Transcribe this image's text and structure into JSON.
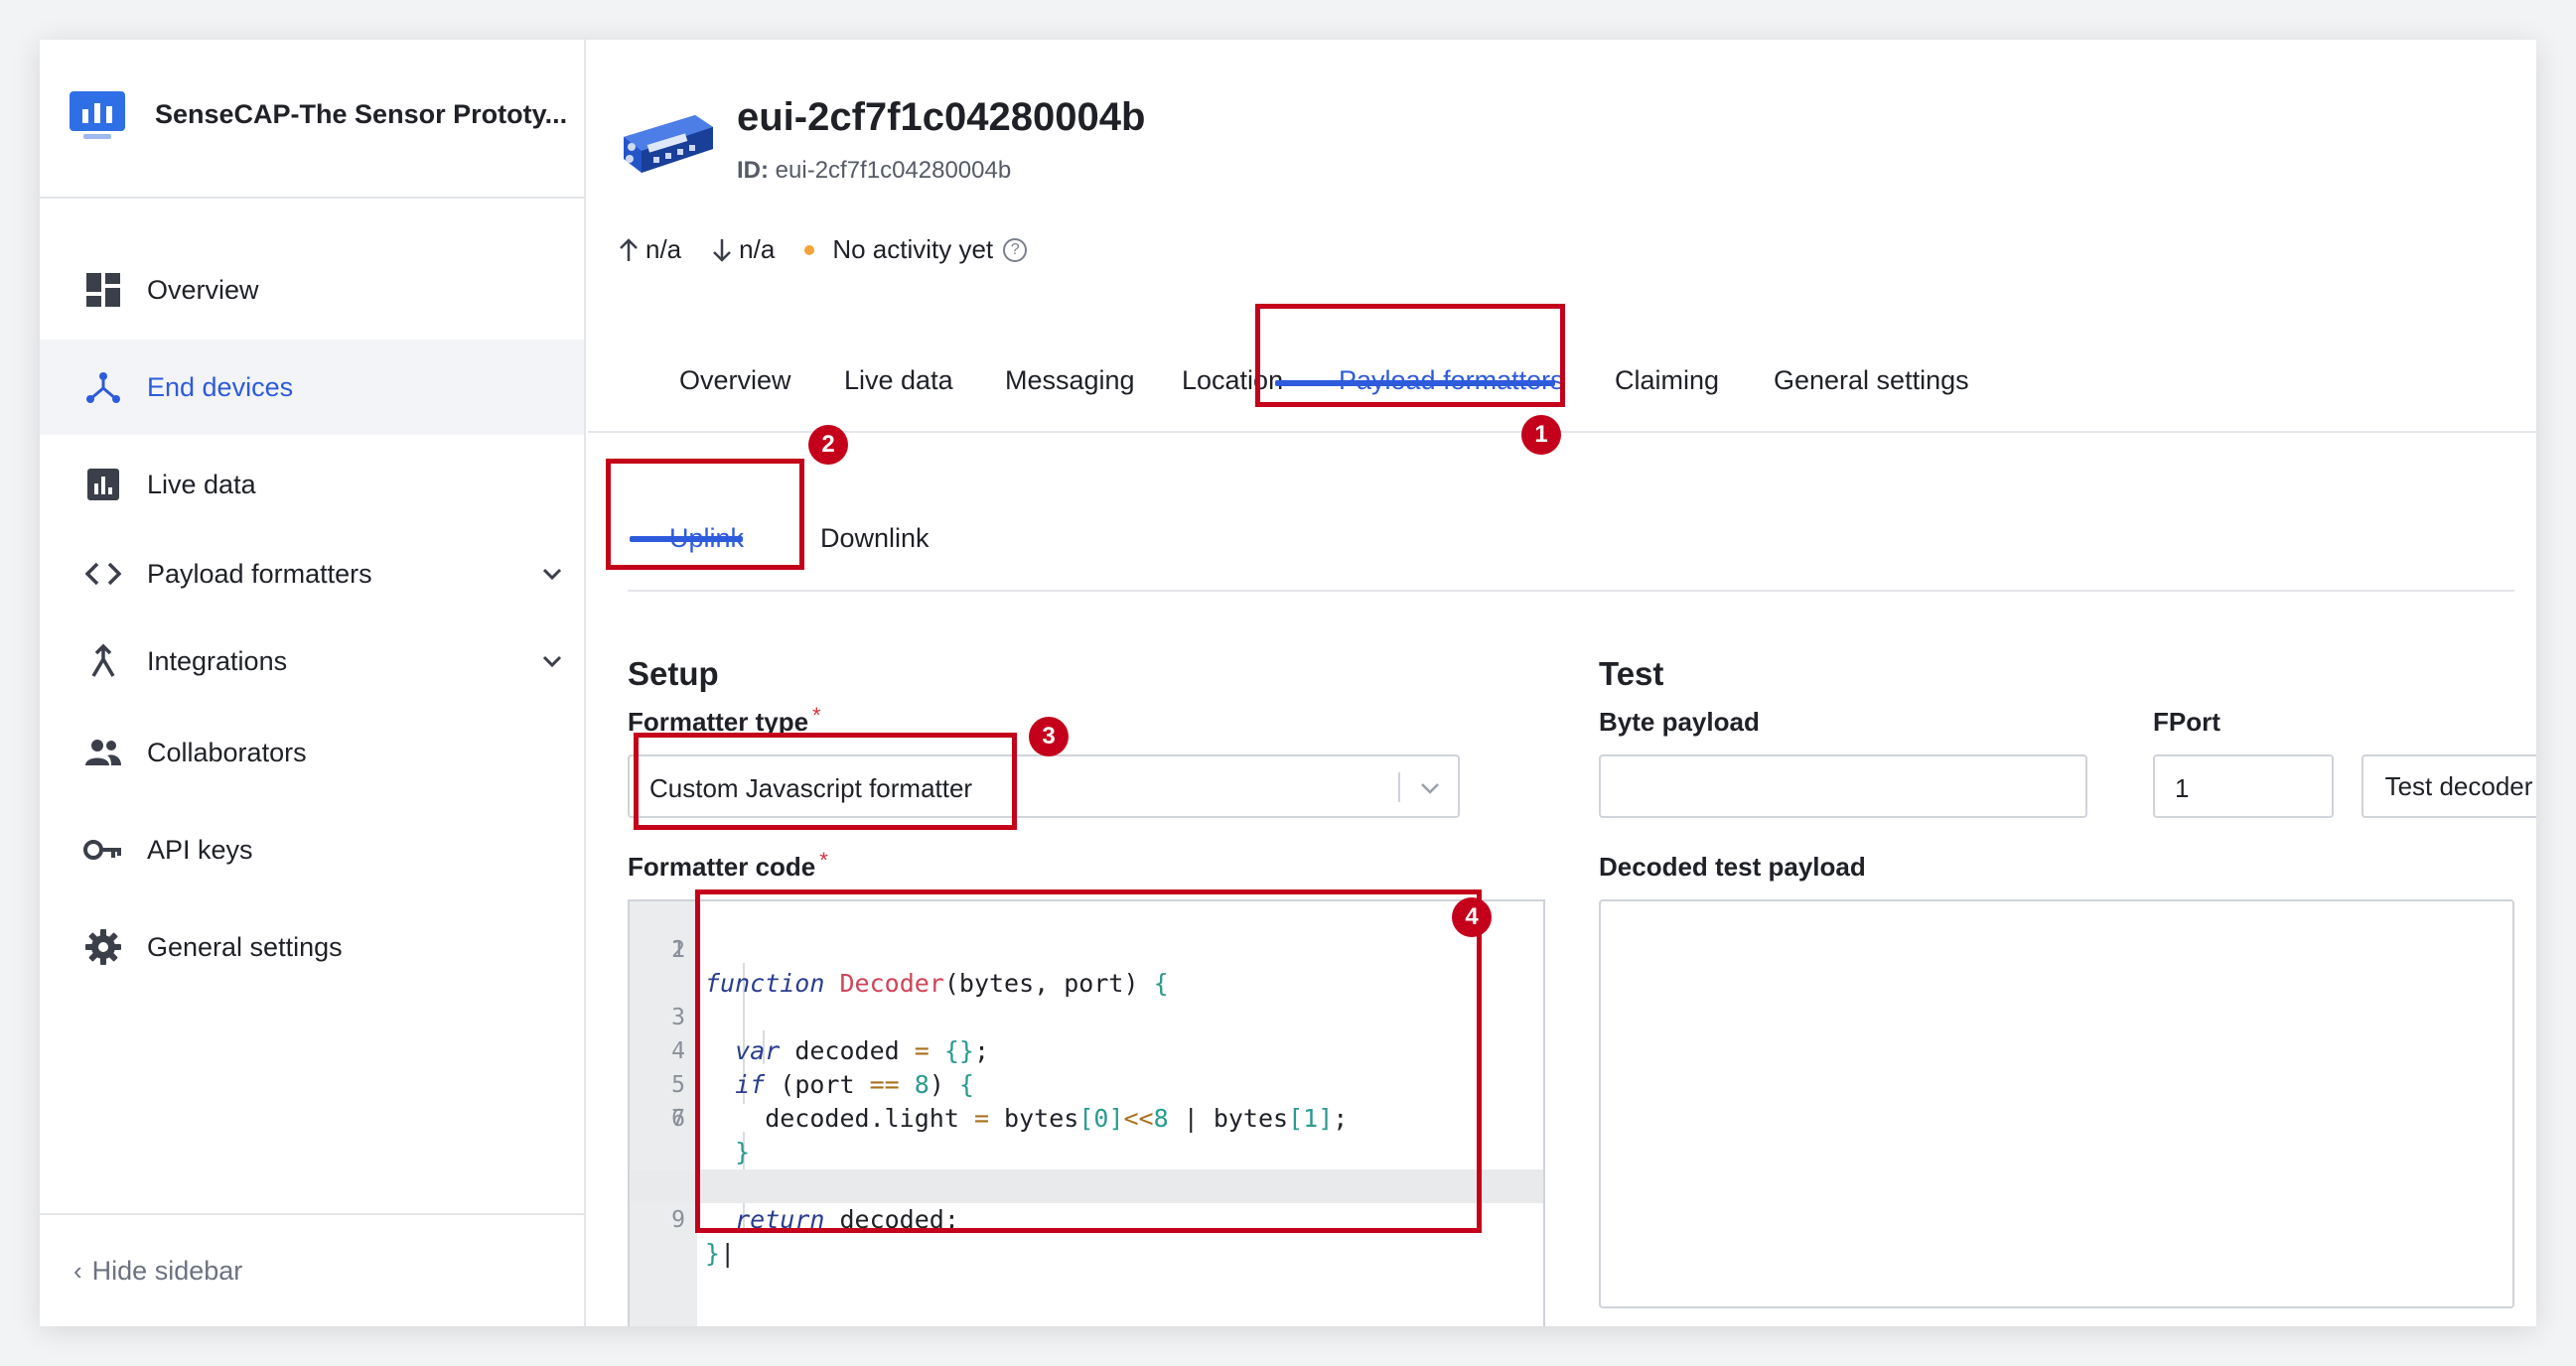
{
  "app": {
    "name": "SenseCAP-The Sensor Prototy..."
  },
  "sidebar": {
    "items": [
      {
        "label": "Overview",
        "icon": "dashboard-icon"
      },
      {
        "label": "End devices",
        "icon": "end-devices-icon",
        "active": true
      },
      {
        "label": "Live data",
        "icon": "live-data-icon"
      },
      {
        "label": "Payload formatters",
        "icon": "code-icon",
        "expandable": true
      },
      {
        "label": "Integrations",
        "icon": "integrations-icon",
        "expandable": true
      },
      {
        "label": "Collaborators",
        "icon": "people-icon"
      },
      {
        "label": "API keys",
        "icon": "key-icon"
      },
      {
        "label": "General settings",
        "icon": "gear-icon"
      }
    ],
    "hide_label": "Hide sidebar"
  },
  "device": {
    "title": "eui-2cf7f1c04280004b",
    "id_label": "ID:",
    "id_value": "eui-2cf7f1c04280004b",
    "uplink_count": "n/a",
    "downlink_count": "n/a",
    "activity": "No activity yet"
  },
  "tabs": [
    "Overview",
    "Live data",
    "Messaging",
    "Location",
    "Payload formatters",
    "Claiming",
    "General settings"
  ],
  "active_tab": "Payload formatters",
  "subtabs": [
    "Uplink",
    "Downlink"
  ],
  "active_subtab": "Uplink",
  "setup": {
    "title": "Setup",
    "formatter_type_label": "Formatter type",
    "formatter_type_value": "Custom Javascript formatter",
    "formatter_code_label": "Formatter code",
    "required_mark": "*",
    "code_lines": [
      "function Decoder(bytes, port) {",
      "",
      "  var decoded = {};",
      "  if (port == 8) {",
      "    decoded.light = bytes[0]<<8 | bytes[1];",
      "  }",
      "",
      "  return decoded;",
      "}"
    ]
  },
  "test": {
    "title": "Test",
    "byte_payload_label": "Byte payload",
    "byte_payload_value": "",
    "fport_label": "FPort",
    "fport_value": "1",
    "test_button": "Test decoder",
    "decoded_label": "Decoded test payload"
  },
  "annotations": [
    "1",
    "2",
    "3",
    "4"
  ],
  "colors": {
    "accent": "#2e5bdc",
    "annotation": "#c4001a",
    "activity_dot": "#f2a33a"
  }
}
